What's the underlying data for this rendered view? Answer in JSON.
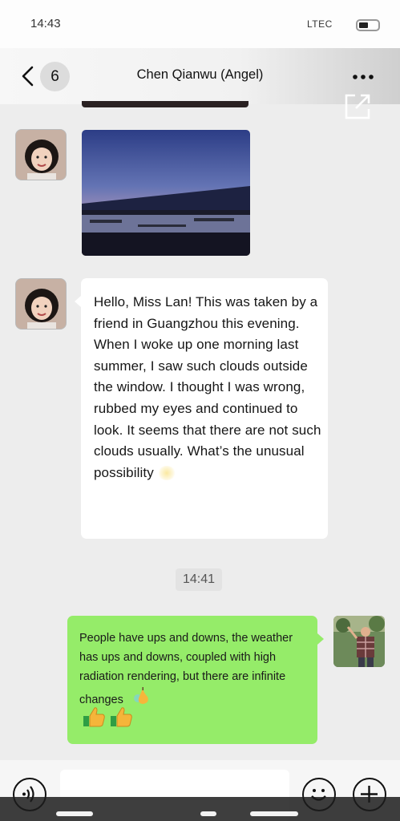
{
  "status_bar": {
    "time": "14:43",
    "network": "LTEC",
    "battery_icon": "battery-icon"
  },
  "header": {
    "back_icon": "chevron-left-icon",
    "unread_count": "6",
    "title": "Chen Qianwu (Angel)",
    "more_icon": "more-dots-icon"
  },
  "overlay": {
    "share_icon": "external-open-icon"
  },
  "messages": [
    {
      "type": "image",
      "sender": "contact",
      "description_icon": "sunset-photo"
    },
    {
      "type": "text",
      "sender": "contact",
      "text": "Hello, Miss Lan! This was taken by a friend in Guangzhou this evening. When I woke up one morning last summer, I saw such clouds outside the window. I thought I was wrong, rubbed my eyes and continued to look. It seems that there are not such clouds usually. What’s the unusual possibility",
      "trailing_emoji": "sun-glow-emoji"
    },
    {
      "type": "timestamp",
      "text": "14:41"
    },
    {
      "type": "text",
      "sender": "self",
      "text": "People have ups and downs, the weather has ups and downs, coupled with high radiation rendering, but there are infinite changes",
      "trailing_emoji": "pear-emoji",
      "emojis": [
        "thumbs-up-emoji",
        "thumbs-up-emoji"
      ]
    }
  ],
  "input_bar": {
    "voice_icon": "voice-icon",
    "emoji_icon": "smiley-icon",
    "plus_icon": "plus-icon"
  },
  "colors": {
    "self_bubble": "#95ec69",
    "contact_bubble": "#ffffff",
    "background": "#ededed"
  }
}
